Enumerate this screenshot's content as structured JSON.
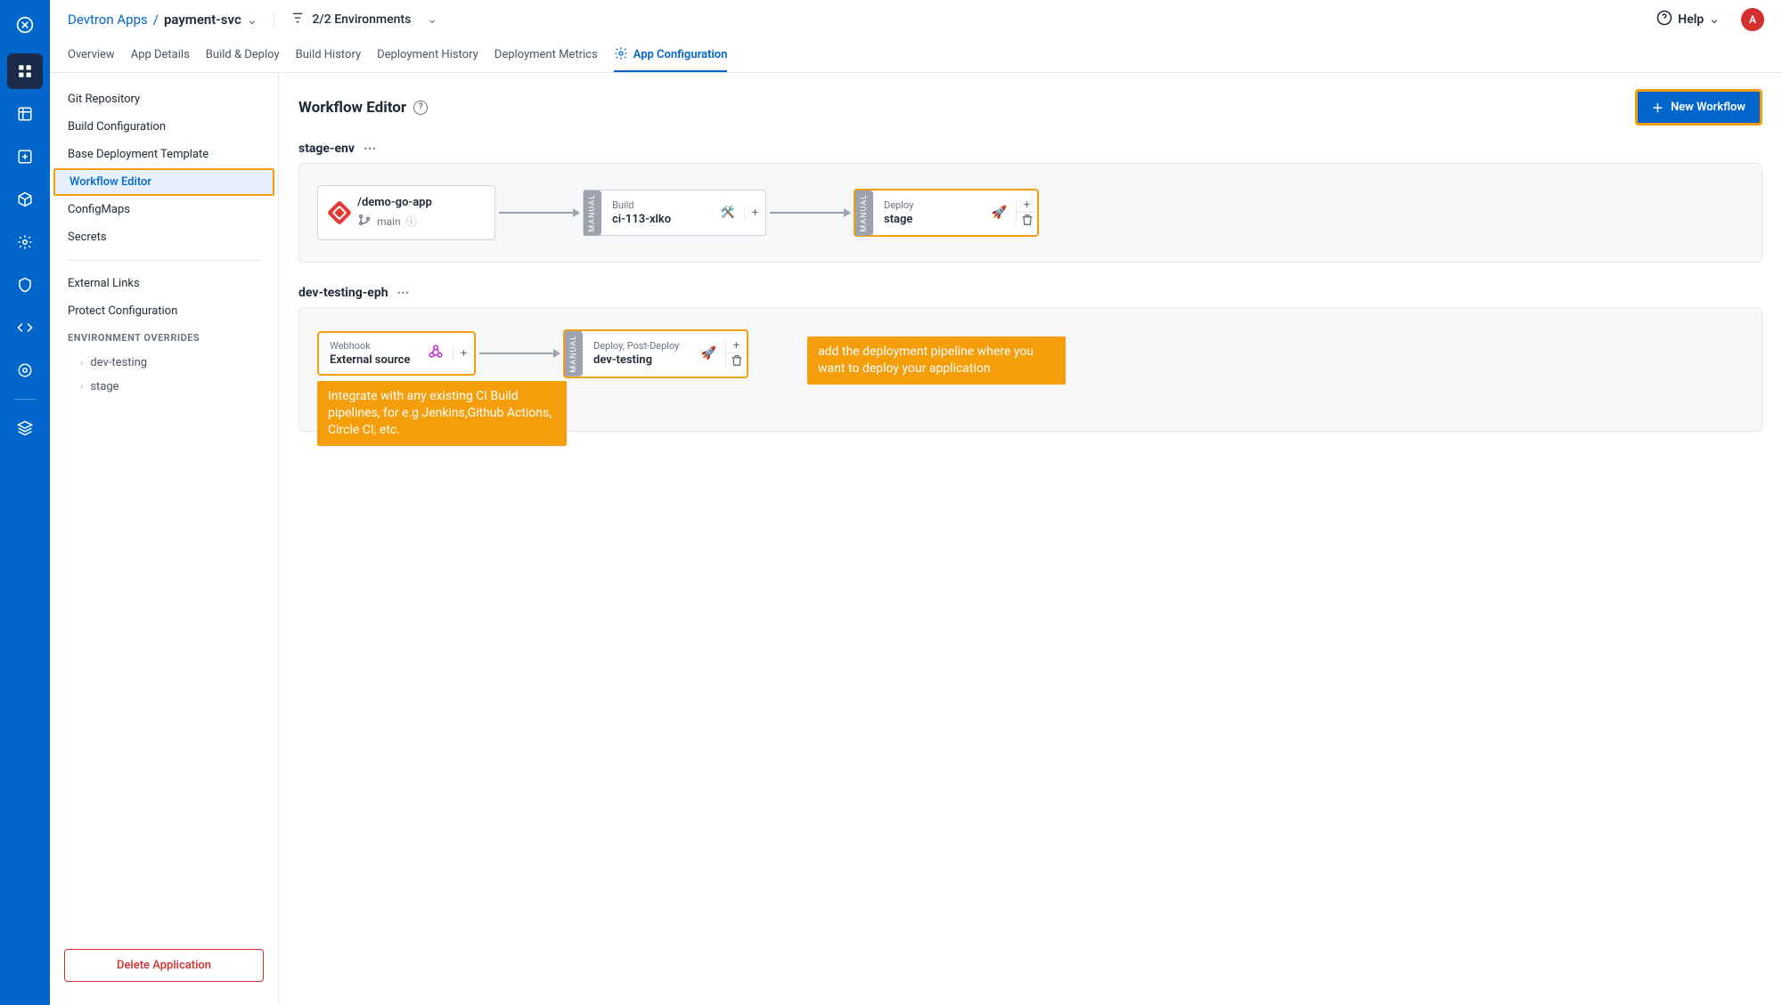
{
  "breadcrumb": {
    "parent": "Devtron Apps",
    "sep": "/",
    "current": "payment-svc"
  },
  "env_filter": "2/2 Environments",
  "help": "Help",
  "avatar": "A",
  "tabs": [
    {
      "label": "Overview"
    },
    {
      "label": "App Details"
    },
    {
      "label": "Build & Deploy"
    },
    {
      "label": "Build History"
    },
    {
      "label": "Deployment History"
    },
    {
      "label": "Deployment Metrics"
    },
    {
      "label": "App Configuration",
      "active": true
    }
  ],
  "sidebar": {
    "items": [
      {
        "label": "Git Repository"
      },
      {
        "label": "Build Configuration"
      },
      {
        "label": "Base Deployment Template"
      },
      {
        "label": "Workflow Editor",
        "active": true
      },
      {
        "label": "ConfigMaps"
      },
      {
        "label": "Secrets"
      }
    ],
    "sec2": [
      {
        "label": "External Links"
      },
      {
        "label": "Protect Configuration"
      }
    ],
    "env_heading": "ENVIRONMENT OVERRIDES",
    "envs": [
      {
        "label": "dev-testing"
      },
      {
        "label": "stage"
      }
    ],
    "delete": "Delete Application"
  },
  "page": {
    "title": "Workflow Editor",
    "new_wf": "New Workflow"
  },
  "workflows": [
    {
      "name": "stage-env",
      "source": {
        "title": "/demo-go-app",
        "branch": "main"
      },
      "build": {
        "label": "Build",
        "value": "ci-113-xlko"
      },
      "deploy": {
        "label": "Deploy",
        "value": "stage"
      }
    },
    {
      "name": "dev-testing-eph",
      "source": {
        "label": "Webhook",
        "value": "External source"
      },
      "deploy": {
        "label": "Deploy, Post-Deploy",
        "value": "dev-testing"
      }
    }
  ],
  "callouts": {
    "webhook": "Integrate with any existing CI Build pipelines, for e.g Jenkins,Github Actions, Circle CI, etc.",
    "deploy": "add the deployment pipeline where you want to deploy your application"
  },
  "manual_label": "MANUAL"
}
